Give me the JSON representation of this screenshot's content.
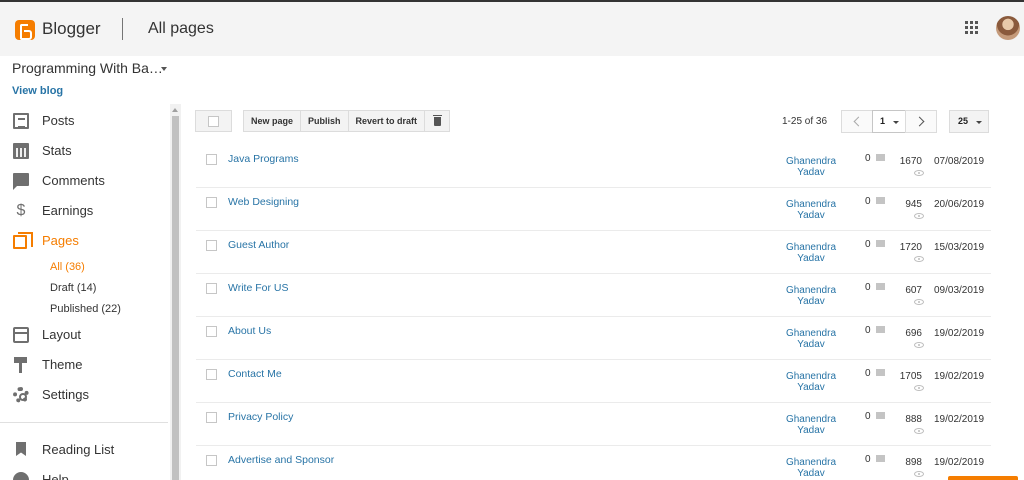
{
  "header": {
    "brand": "Blogger",
    "page_title": "All pages",
    "apps_icon": "apps-grid-icon",
    "avatar_icon": "user-avatar"
  },
  "blog": {
    "name": "Programming With Ba…",
    "view_blog": "View blog"
  },
  "sidebar": {
    "items": [
      {
        "label": "Posts",
        "icon": "posts-icon"
      },
      {
        "label": "Stats",
        "icon": "stats-icon"
      },
      {
        "label": "Comments",
        "icon": "comments-icon"
      },
      {
        "label": "Earnings",
        "icon": "earnings-icon"
      },
      {
        "label": "Pages",
        "icon": "pages-icon",
        "active": true
      },
      {
        "label": "Layout",
        "icon": "layout-icon"
      },
      {
        "label": "Theme",
        "icon": "theme-icon"
      },
      {
        "label": "Settings",
        "icon": "settings-icon"
      },
      {
        "label": "Reading List",
        "icon": "reading-list-icon"
      },
      {
        "label": "Help",
        "icon": "help-icon"
      }
    ],
    "sub_items": [
      {
        "label": "All (36)",
        "active": true
      },
      {
        "label": "Draft (14)"
      },
      {
        "label": "Published (22)"
      }
    ]
  },
  "toolbar": {
    "new_page": "New page",
    "publish": "Publish",
    "revert": "Revert to draft",
    "delete_icon": "trash-icon"
  },
  "pager": {
    "range": "1-25 of 36",
    "current_page": "1",
    "per_page": "25"
  },
  "pages": [
    {
      "title": "Java Programs",
      "author": "Ghanendra Yadav",
      "comments": "0",
      "views": "1670",
      "date": "07/08/2019"
    },
    {
      "title": "Web Designing",
      "author": "Ghanendra Yadav",
      "comments": "0",
      "views": "945",
      "date": "20/06/2019"
    },
    {
      "title": "Guest Author",
      "author": "Ghanendra Yadav",
      "comments": "0",
      "views": "1720",
      "date": "15/03/2019"
    },
    {
      "title": "Write For US",
      "author": "Ghanendra Yadav",
      "comments": "0",
      "views": "607",
      "date": "09/03/2019"
    },
    {
      "title": "About Us",
      "author": "Ghanendra Yadav",
      "comments": "0",
      "views": "696",
      "date": "19/02/2019"
    },
    {
      "title": "Contact Me",
      "author": "Ghanendra Yadav",
      "comments": "0",
      "views": "1705",
      "date": "19/02/2019"
    },
    {
      "title": "Privacy Policy",
      "author": "Ghanendra Yadav",
      "comments": "0",
      "views": "888",
      "date": "19/02/2019"
    },
    {
      "title": "Advertise and Sponsor",
      "author": "Ghanendra Yadav",
      "comments": "0",
      "views": "898",
      "date": "19/02/2019"
    }
  ],
  "colors": {
    "accent": "#f57d00",
    "link": "#2874a6"
  }
}
